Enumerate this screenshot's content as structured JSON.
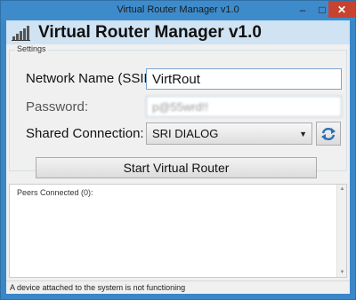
{
  "window": {
    "title": "Virtual Router Manager v1.0",
    "controls": {
      "minimize": "–",
      "maximize": "□",
      "close": "✕"
    }
  },
  "header": {
    "app_title": "Virtual Router Manager v1.0",
    "icon": "signal-bars-icon"
  },
  "settings": {
    "legend": "Settings",
    "ssid_label": "Network Name (SSID):",
    "ssid_value": "VirtRout",
    "password_label": "Password:",
    "password_value": "p@55wrd!!",
    "shared_label": "Shared Connection:",
    "shared_value": "SRI DIALOG",
    "refresh_icon": "refresh-icon"
  },
  "actions": {
    "start_label": "Start Virtual Router"
  },
  "peers": {
    "label": "Peers Connected (0):",
    "count": 0
  },
  "status": {
    "text": "A device attached to the system is not functioning"
  },
  "colors": {
    "titlebar": "#3e8bcc",
    "header": "#cfe3f3",
    "close": "#c7432f"
  }
}
